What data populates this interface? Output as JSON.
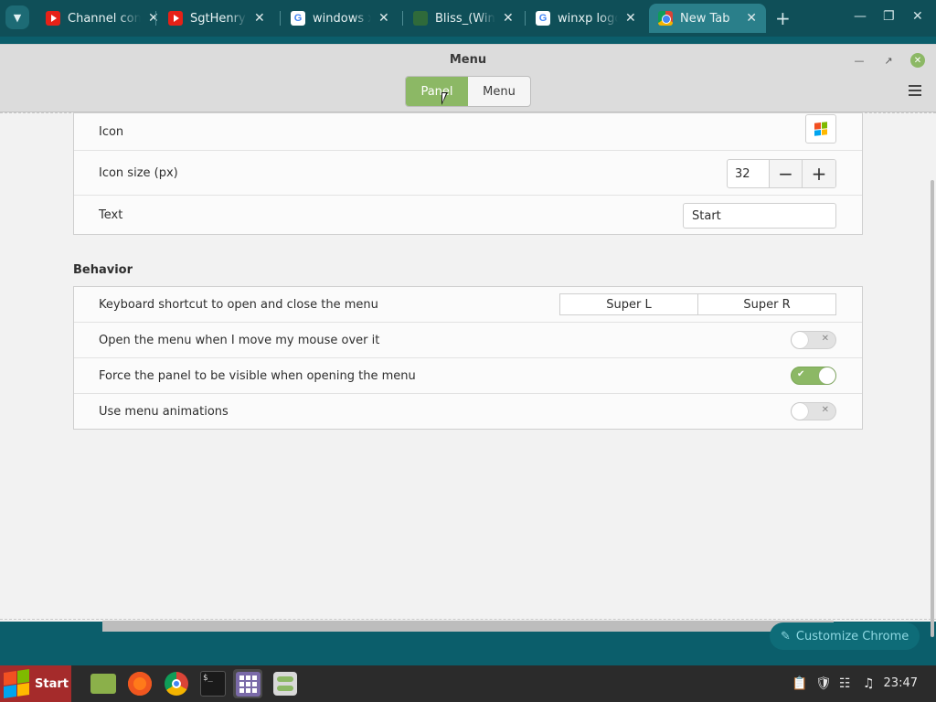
{
  "browser": {
    "tabs": [
      {
        "title": "Channel content",
        "favicon": "youtube-icon",
        "active": false
      },
      {
        "title": "SgtHenryP",
        "favicon": "youtube-icon",
        "active": false
      },
      {
        "title": "windows xp",
        "favicon": "google-icon",
        "active": false
      },
      {
        "title": "Bliss_(Windows)",
        "favicon": "bliss-icon",
        "active": false
      },
      {
        "title": "winxp logo",
        "favicon": "google-icon",
        "active": false
      },
      {
        "title": "New Tab",
        "favicon": "chrome-icon",
        "active": true
      }
    ],
    "customize_label": "Customize Chrome"
  },
  "window": {
    "title": "Menu",
    "segments": {
      "panel": "Panel",
      "menu": "Menu"
    },
    "active_segment": "Panel"
  },
  "panel_settings": {
    "icon_label": "Icon",
    "icon_size_label": "Icon size (px)",
    "icon_size_value": "32",
    "text_label": "Text",
    "text_value": "Start"
  },
  "behavior": {
    "heading": "Behavior",
    "shortcut_label": "Keyboard shortcut to open and close the menu",
    "shortcut_1": "Super L",
    "shortcut_2": "Super R",
    "hover_label": "Open the menu when I move my mouse over it",
    "hover_enabled": false,
    "force_panel_label": "Force the panel to be visible when opening the menu",
    "force_panel_enabled": true,
    "animations_label": "Use menu animations",
    "animations_enabled": false
  },
  "taskbar": {
    "start_label": "Start",
    "apps": [
      "files-icon",
      "firefox-icon",
      "chrome-icon",
      "terminal-icon",
      "app-grid-icon",
      "settings-icon"
    ],
    "clock": "23:47"
  },
  "colors": {
    "accent_green": "#8cb865",
    "start_red": "#a52b2b",
    "teal": "#0f4f58"
  }
}
